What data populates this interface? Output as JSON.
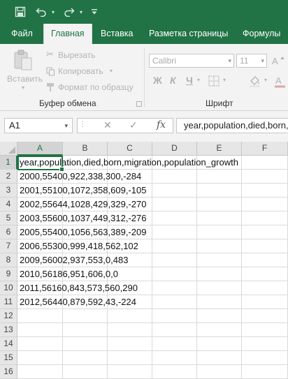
{
  "ribbon_tabs": {
    "file": "Файл",
    "home": "Главная",
    "insert": "Вставка",
    "page_layout": "Разметка страницы",
    "formulas": "Формулы"
  },
  "clipboard": {
    "paste": "Вставить",
    "cut": "Вырезать",
    "copy": "Копировать",
    "format_painter": "Формат по образцу",
    "group_title": "Буфер обмена"
  },
  "font": {
    "name": "Calibri",
    "size": "11",
    "bold": "Ж",
    "italic": "К",
    "underline": "Ч",
    "group_title": "Шрифт"
  },
  "formula_bar": {
    "name_box": "A1",
    "cancel": "✕",
    "enter": "✓",
    "fx": "fx",
    "content": "year,population,died,born,migration,population_growth"
  },
  "sheet": {
    "columns": [
      "A",
      "B",
      "C",
      "D",
      "E",
      "F"
    ],
    "rows": [
      "1",
      "2",
      "3",
      "4",
      "5",
      "6",
      "7",
      "8",
      "9",
      "10",
      "11",
      "12",
      "13",
      "14",
      "15",
      "16"
    ],
    "cells": [
      "year,population,died,born,migration,population_growth",
      "2000,55400,922,338,300,-284",
      "2001,55100,1072,358,609,-105",
      "2002,55644,1028,429,329,-270",
      "2003,55600,1037,449,312,-276",
      "2005,55400,1056,563,389,-209",
      "2006,55300,999,418,562,102",
      "2009,56002,937,553,0,483",
      "2010,56186,951,606,0,0",
      "2011,56160,843,573,560,290",
      "2012,56440,879,592,43,-224"
    ]
  },
  "colors": {
    "accent": "#217346"
  }
}
